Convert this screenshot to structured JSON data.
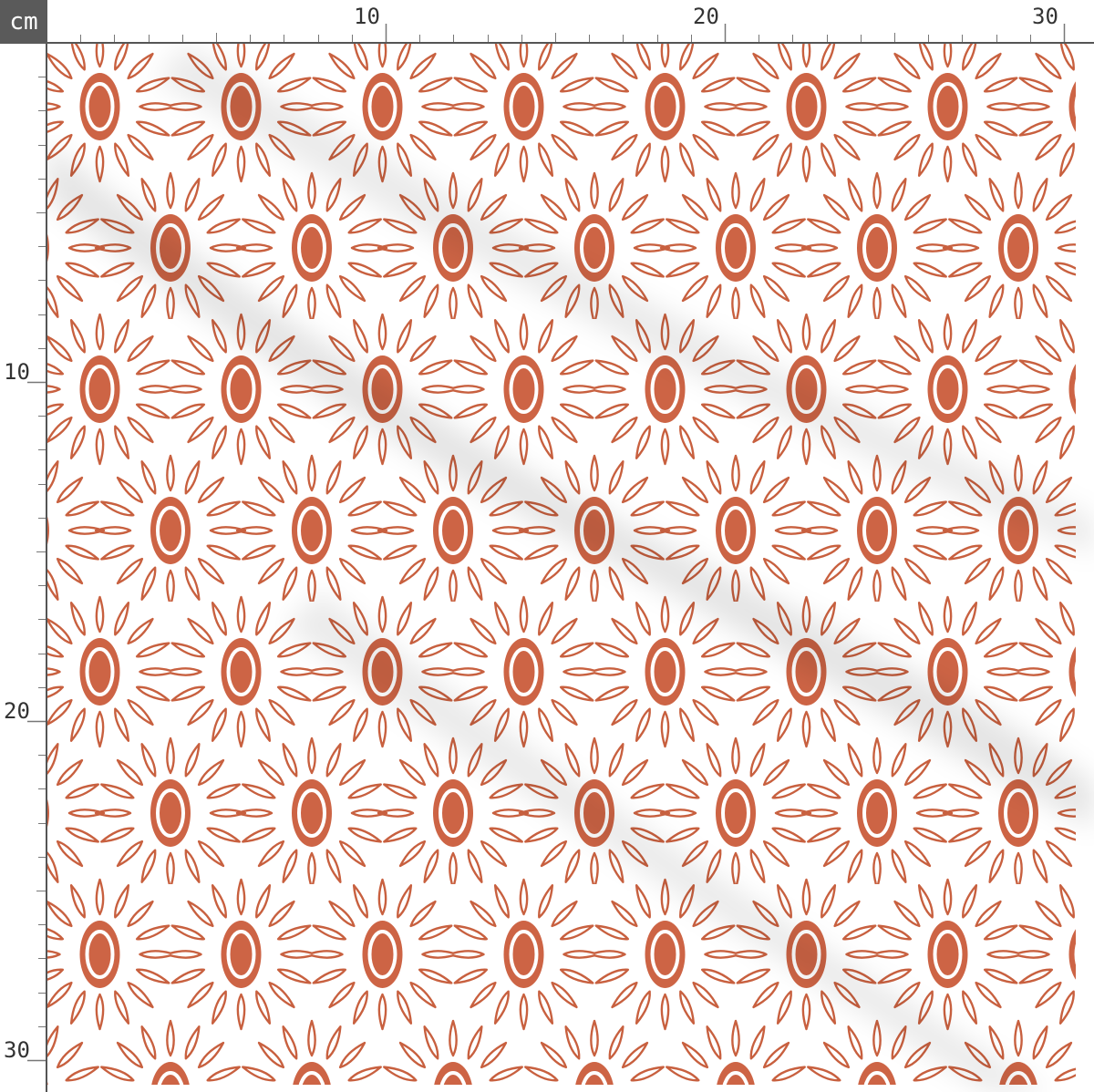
{
  "ruler": {
    "unit": "cm",
    "top_labels": [
      "10",
      "20",
      "30"
    ],
    "left_labels": [
      "10",
      "20",
      "30"
    ]
  },
  "pattern": {
    "motif": "sunburst flowers with oval centers and teardrop petals",
    "background_color": "#ffffff",
    "motif_color": "#c8603f",
    "center_fill_color": "#cd6445"
  }
}
